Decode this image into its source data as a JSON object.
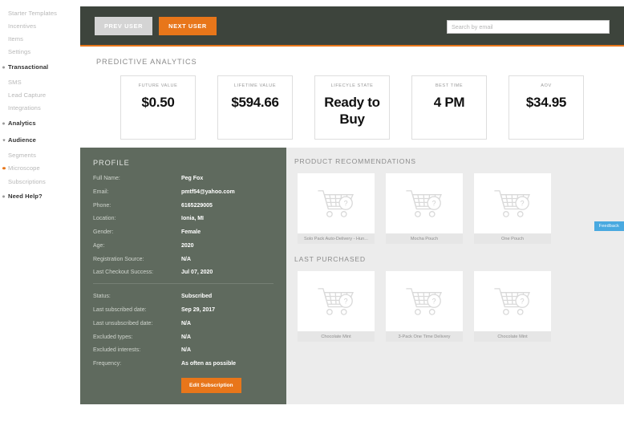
{
  "sidebar": {
    "items": [
      {
        "label": "Starter Templates",
        "style": "sub",
        "marker": "none"
      },
      {
        "label": "Incentives",
        "style": "sub",
        "marker": "none"
      },
      {
        "label": "Items",
        "style": "sub",
        "marker": "none"
      },
      {
        "label": "Settings",
        "style": "sub",
        "marker": "none"
      },
      {
        "label": "Transactional",
        "style": "bold",
        "marker": "bullet"
      },
      {
        "label": "SMS",
        "style": "sub",
        "marker": "none"
      },
      {
        "label": "Lead Capture",
        "style": "sub",
        "marker": "none"
      },
      {
        "label": "Integrations",
        "style": "sub",
        "marker": "none"
      },
      {
        "label": "Analytics",
        "style": "bold",
        "marker": "bullet"
      },
      {
        "label": "Audience",
        "style": "bold",
        "marker": "caret"
      },
      {
        "label": "Segments",
        "style": "sub",
        "marker": "none"
      },
      {
        "label": "Microscope",
        "style": "sub",
        "marker": "orange"
      },
      {
        "label": "Subscriptions",
        "style": "sub",
        "marker": "none"
      },
      {
        "label": "Need Help?",
        "style": "bold",
        "marker": "bullet"
      }
    ]
  },
  "toolbar": {
    "prev_label": "PREV USER",
    "next_label": "NEXT USER",
    "search_placeholder": "Search by email",
    "search_value": ""
  },
  "predictive": {
    "title": "PREDICTIVE ANALYTICS",
    "cards": [
      {
        "label": "FUTURE VALUE",
        "value": "$0.50"
      },
      {
        "label": "LIFETIME VALUE",
        "value": "$594.66"
      },
      {
        "label": "LIFECYLE STATE",
        "value": "Ready to Buy"
      },
      {
        "label": "BEST TIME",
        "value": "4 PM"
      },
      {
        "label": "AOV",
        "value": "$34.95"
      }
    ]
  },
  "profile": {
    "title": "PROFILE",
    "fields_top": [
      {
        "key": "Full Name:",
        "value": "Peg Fox"
      },
      {
        "key": "Email:",
        "value": "pmtf54@yahoo.com"
      },
      {
        "key": "Phone:",
        "value": "6165229005"
      },
      {
        "key": "Location:",
        "value": "Ionia, MI"
      },
      {
        "key": "Gender:",
        "value": "Female"
      },
      {
        "key": "Age:",
        "value": "2020"
      },
      {
        "key": "Registration Source:",
        "value": "N/A"
      },
      {
        "key": "Last Checkout Success:",
        "value": "Jul 07, 2020"
      }
    ],
    "fields_bottom": [
      {
        "key": "Status:",
        "value": "Subscribed"
      },
      {
        "key": "Last subscribed date:",
        "value": "Sep 29, 2017"
      },
      {
        "key": "Last unsubscribed date:",
        "value": "N/A"
      },
      {
        "key": "Excluded types:",
        "value": "N/A"
      },
      {
        "key": "Excluded interests:",
        "value": "N/A"
      },
      {
        "key": "Frequency:",
        "value": "As often as possible"
      }
    ],
    "edit_button": "Edit Subscription"
  },
  "recommendations": {
    "title": "PRODUCT RECOMMENDATIONS",
    "items": [
      {
        "caption": "Solo Pack Auto-Delivery - Hun...",
        "icon": "cart-placeholder-icon"
      },
      {
        "caption": "Mocha Pouch",
        "icon": "cart-placeholder-icon"
      },
      {
        "caption": "One Pouch",
        "icon": "cart-placeholder-icon"
      }
    ]
  },
  "last_purchased": {
    "title": "LAST PURCHASED",
    "items": [
      {
        "caption": "Chocolate Mint",
        "icon": "cart-placeholder-icon"
      },
      {
        "caption": "3-Pack One Time Delivery",
        "icon": "cart-placeholder-icon"
      },
      {
        "caption": "Chocolate Mint",
        "icon": "cart-placeholder-icon"
      }
    ]
  },
  "feedback": {
    "label": "Feedback"
  },
  "colors": {
    "accent_orange": "#e8761a",
    "header_dark": "#3d443c",
    "profile_panel": "#5f6a5e",
    "panel_gray": "#ececec",
    "feedback_blue": "#49a9e0"
  }
}
